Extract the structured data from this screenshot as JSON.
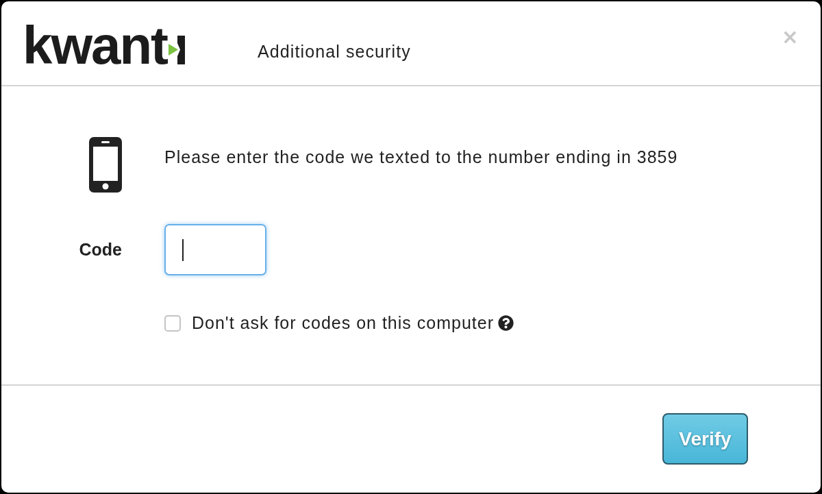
{
  "header": {
    "logo": {
      "text": "kwant"
    },
    "title": "Additional security",
    "close_symbol": "×"
  },
  "body": {
    "message": "Please enter the code we texted to the number ending in 3859",
    "code_field": {
      "label": "Code",
      "focused": true
    },
    "remember": {
      "label": "Don't ask for codes on this computer",
      "checked": false
    }
  },
  "footer": {
    "buttons": [
      {
        "label": "Verify",
        "kind": "primary"
      }
    ]
  }
}
